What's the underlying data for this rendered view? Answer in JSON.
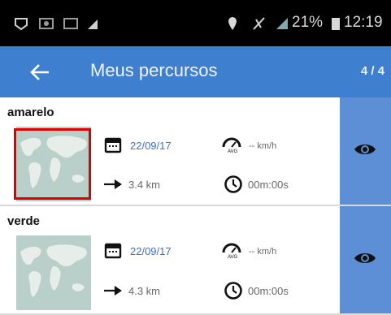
{
  "status_bar": {
    "battery": "21%",
    "time": "12:19"
  },
  "app_bar": {
    "title": "Meus percursos",
    "counter": "4 / 4"
  },
  "routes": [
    {
      "name": "amarelo",
      "date": "22/09/17",
      "avg_speed": "-- km/h",
      "distance": "3.4 km",
      "duration": "00m:00s"
    },
    {
      "name": "verde",
      "date": "22/09/17",
      "avg_speed": "-- km/h",
      "distance": "4.3 km",
      "duration": "00m:00s"
    }
  ],
  "icons": {
    "back": "arrow-left-icon",
    "calendar": "calendar-icon",
    "speedometer": "speedometer-avg-icon",
    "distance": "arrow-right-icon",
    "clock": "clock-icon",
    "view": "eye-icon"
  },
  "colors": {
    "app_bar": "#3f7fd0",
    "view_column": "#5c8fd6",
    "date_text": "#3b6fd0",
    "highlight": "#e10000"
  }
}
